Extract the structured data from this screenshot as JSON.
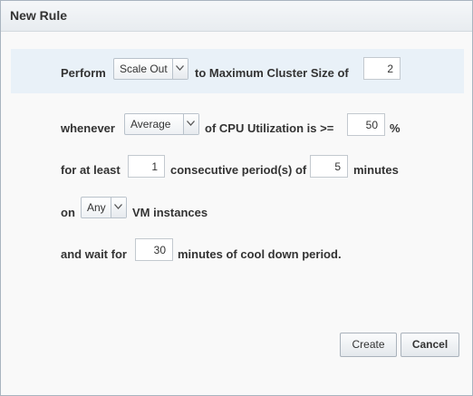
{
  "dialog": {
    "title": "New Rule"
  },
  "perform_row": {
    "label_perform": "Perform",
    "action_select": "Scale Out",
    "label_to": "to Maximum Cluster Size of",
    "max_size": "2"
  },
  "whenever_row": {
    "label_whenever": "whenever",
    "aggregate_select": "Average",
    "label_metric": "of CPU Utilization is >=",
    "threshold": "50",
    "label_percent": "%"
  },
  "period_row": {
    "label_for": "for at least",
    "periods": "1",
    "label_consecutive": "consecutive period(s) of",
    "period_minutes": "5",
    "label_minutes": "minutes"
  },
  "on_row": {
    "label_on": "on",
    "instance_select": "Any",
    "label_vm": "VM instances"
  },
  "wait_row": {
    "label_wait": "and wait for",
    "cooldown": "30",
    "label_cooldown": "minutes of cool down period."
  },
  "buttons": {
    "create": "Create",
    "cancel": "Cancel"
  }
}
